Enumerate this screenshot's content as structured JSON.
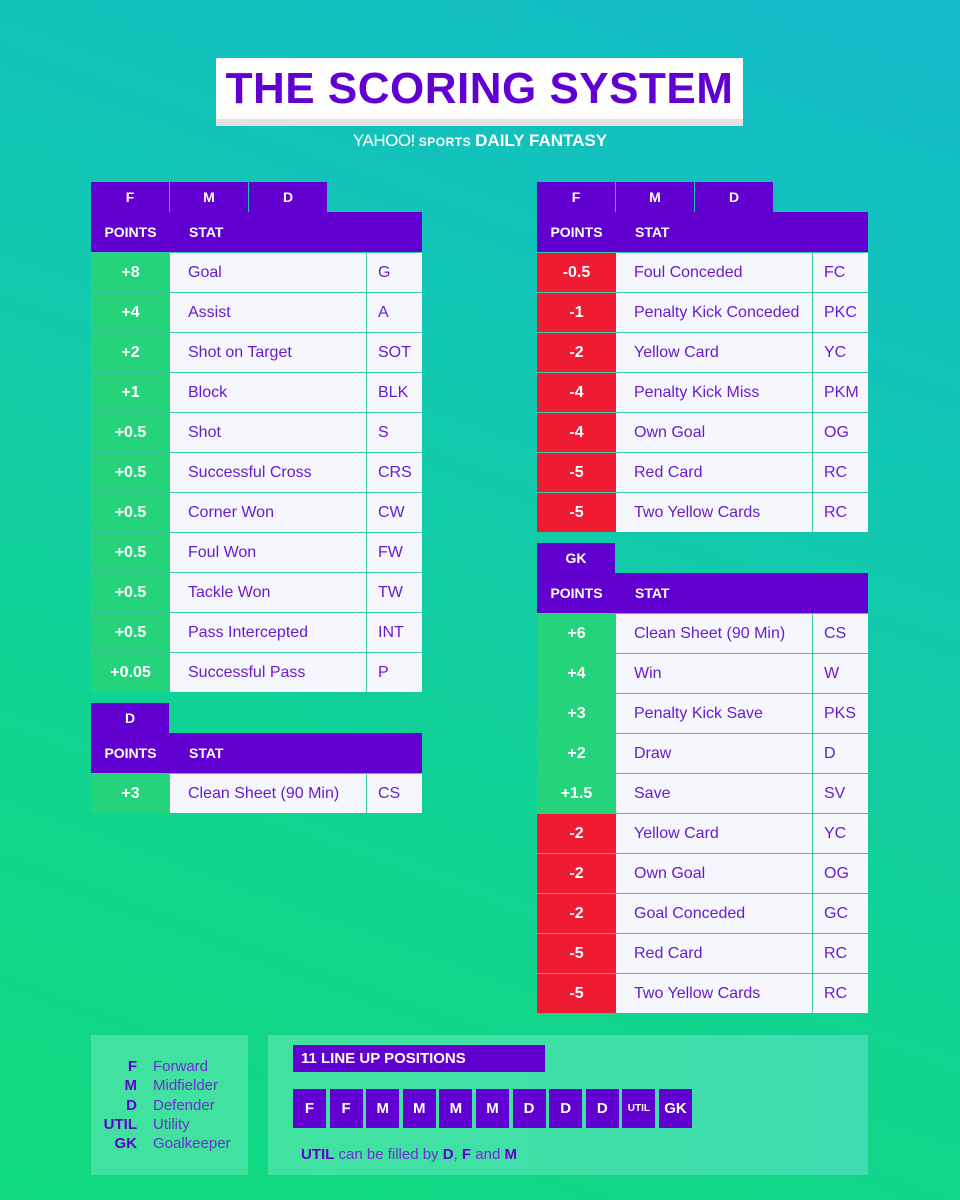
{
  "header": {
    "title": "THE SCORING SYSTEM",
    "brand_yahoo": "YAHOO!",
    "brand_sports": "SPORTS",
    "brand_product": "DAILY FANTASY"
  },
  "column_labels": {
    "points": "POINTS",
    "stat": "STAT"
  },
  "tables": {
    "fmd_positive": {
      "positions": [
        "F",
        "M",
        "D"
      ],
      "rows": [
        {
          "points": "+8",
          "stat": "Goal",
          "abbr": "G",
          "sign": "pos"
        },
        {
          "points": "+4",
          "stat": "Assist",
          "abbr": "A",
          "sign": "pos"
        },
        {
          "points": "+2",
          "stat": "Shot on Target",
          "abbr": "SOT",
          "sign": "pos"
        },
        {
          "points": "+1",
          "stat": "Block",
          "abbr": "BLK",
          "sign": "pos"
        },
        {
          "points": "+0.5",
          "stat": "Shot",
          "abbr": "S",
          "sign": "pos"
        },
        {
          "points": "+0.5",
          "stat": "Successful Cross",
          "abbr": "CRS",
          "sign": "pos"
        },
        {
          "points": "+0.5",
          "stat": "Corner Won",
          "abbr": "CW",
          "sign": "pos"
        },
        {
          "points": "+0.5",
          "stat": "Foul Won",
          "abbr": "FW",
          "sign": "pos"
        },
        {
          "points": "+0.5",
          "stat": "Tackle Won",
          "abbr": "TW",
          "sign": "pos"
        },
        {
          "points": "+0.5",
          "stat": "Pass Intercepted",
          "abbr": "INT",
          "sign": "pos"
        },
        {
          "points": "+0.05",
          "stat": "Successful Pass",
          "abbr": "P",
          "sign": "pos"
        }
      ]
    },
    "d_only": {
      "positions": [
        "D"
      ],
      "rows": [
        {
          "points": "+3",
          "stat": "Clean Sheet (90 Min)",
          "abbr": "CS",
          "sign": "pos"
        }
      ]
    },
    "fmd_negative": {
      "positions": [
        "F",
        "M",
        "D"
      ],
      "rows": [
        {
          "points": "-0.5",
          "stat": "Foul Conceded",
          "abbr": "FC",
          "sign": "neg"
        },
        {
          "points": "-1",
          "stat": "Penalty Kick Conceded",
          "abbr": "PKC",
          "sign": "neg"
        },
        {
          "points": "-2",
          "stat": "Yellow Card",
          "abbr": "YC",
          "sign": "neg"
        },
        {
          "points": "-4",
          "stat": "Penalty Kick Miss",
          "abbr": "PKM",
          "sign": "neg"
        },
        {
          "points": "-4",
          "stat": "Own Goal",
          "abbr": "OG",
          "sign": "neg"
        },
        {
          "points": "-5",
          "stat": "Red Card",
          "abbr": "RC",
          "sign": "neg"
        },
        {
          "points": "-5",
          "stat": "Two Yellow Cards",
          "abbr": "RC",
          "sign": "neg"
        }
      ]
    },
    "gk": {
      "positions": [
        "GK"
      ],
      "rows": [
        {
          "points": "+6",
          "stat": "Clean Sheet (90 Min)",
          "abbr": "CS",
          "sign": "pos"
        },
        {
          "points": "+4",
          "stat": "Win",
          "abbr": "W",
          "sign": "pos"
        },
        {
          "points": "+3",
          "stat": "Penalty Kick Save",
          "abbr": "PKS",
          "sign": "pos"
        },
        {
          "points": "+2",
          "stat": "Draw",
          "abbr": "D",
          "sign": "pos"
        },
        {
          "points": "+1.5",
          "stat": "Save",
          "abbr": "SV",
          "sign": "pos"
        },
        {
          "points": "-2",
          "stat": "Yellow Card",
          "abbr": "YC",
          "sign": "neg"
        },
        {
          "points": "-2",
          "stat": "Own Goal",
          "abbr": "OG",
          "sign": "neg"
        },
        {
          "points": "-2",
          "stat": "Goal Conceded",
          "abbr": "GC",
          "sign": "neg"
        },
        {
          "points": "-5",
          "stat": "Red Card",
          "abbr": "RC",
          "sign": "neg"
        },
        {
          "points": "-5",
          "stat": "Two Yellow Cards",
          "abbr": "RC",
          "sign": "neg"
        }
      ]
    }
  },
  "legend": [
    {
      "key": "F",
      "label": "Forward"
    },
    {
      "key": "M",
      "label": "Midfielder"
    },
    {
      "key": "D",
      "label": "Defender"
    },
    {
      "key": "UTIL",
      "label": "Utility"
    },
    {
      "key": "GK",
      "label": "Goalkeeper"
    }
  ],
  "lineup": {
    "title": "11 LINE UP POSITIONS",
    "slots": [
      "F",
      "F",
      "M",
      "M",
      "M",
      "M",
      "D",
      "D",
      "D",
      "UTIL",
      "GK"
    ],
    "note": {
      "util": "UTIL",
      "text1": " can be filled by ",
      "d": "D",
      "comma": ", ",
      "f": "F",
      "and": " and ",
      "m": "M"
    }
  },
  "colors": {
    "purple": "#6100d1",
    "positive": "#25d47a",
    "negative": "#ee1b32",
    "cell_bg": "#f6f6fd"
  }
}
